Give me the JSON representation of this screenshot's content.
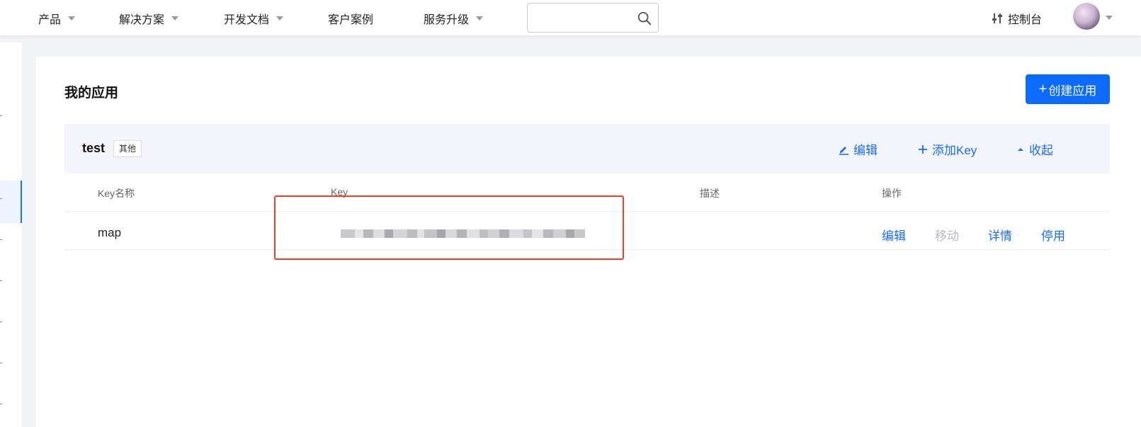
{
  "nav": {
    "items": [
      {
        "label": "产品",
        "has_dropdown": true
      },
      {
        "label": "解决方案",
        "has_dropdown": true
      },
      {
        "label": "开发文档",
        "has_dropdown": true
      },
      {
        "label": "客户案例",
        "has_dropdown": false
      },
      {
        "label": "服务升级",
        "has_dropdown": true
      }
    ],
    "search": {
      "value": "",
      "placeholder": "",
      "icon": "search-icon"
    },
    "console_label": "控制台",
    "console_icon": "sliders-icon",
    "avatar_icon": "user-avatar"
  },
  "page": {
    "title": "我的应用",
    "create_button": {
      "plus": "+",
      "label": "创建应用"
    }
  },
  "app": {
    "name": "test",
    "tag": "其他",
    "actions": {
      "edit": "编辑",
      "add_key": "添加Key",
      "collapse": "收起"
    }
  },
  "table": {
    "headers": {
      "name": "Key名称",
      "key": "Key",
      "desc": "描述",
      "ops": "操作"
    },
    "rows": [
      {
        "name": "map",
        "key": "(blurred)",
        "desc": "",
        "ops": {
          "edit": "编辑",
          "move": "移动",
          "detail": "详情",
          "disable": "停用"
        }
      }
    ]
  },
  "colors": {
    "accent": "#1a6ef7",
    "button": "#0b6bff",
    "highlight": "#e8412c",
    "disabled": "#b6b9c2"
  }
}
